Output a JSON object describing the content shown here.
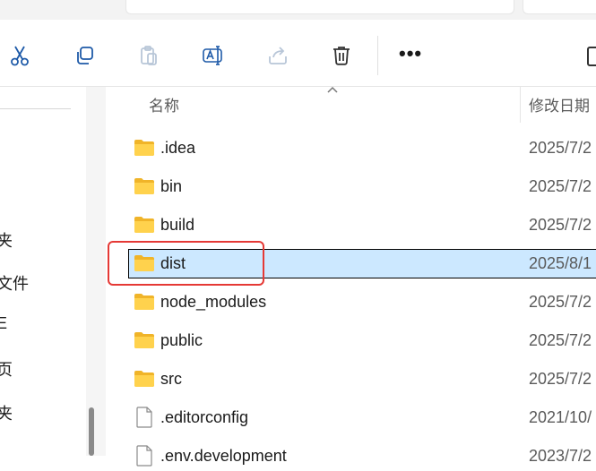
{
  "toolbar": {
    "buttons": [
      {
        "name": "cut-icon"
      },
      {
        "name": "copy-icon"
      },
      {
        "name": "paste-icon"
      },
      {
        "name": "rename-icon"
      },
      {
        "name": "share-icon"
      },
      {
        "name": "delete-icon"
      }
    ],
    "more_label": "•••"
  },
  "nav": {
    "items": [
      "夹",
      "文件",
      "E",
      "页",
      "夹"
    ]
  },
  "list": {
    "columns": {
      "name": "名称",
      "date": "修改日期"
    },
    "rows": [
      {
        "name": ".idea",
        "date": "2025/7/2",
        "type": "folder",
        "selected": false
      },
      {
        "name": "bin",
        "date": "2025/7/2",
        "type": "folder",
        "selected": false
      },
      {
        "name": "build",
        "date": "2025/7/2",
        "type": "folder",
        "selected": false
      },
      {
        "name": "dist",
        "date": "2025/8/1",
        "type": "folder",
        "selected": true
      },
      {
        "name": "node_modules",
        "date": "2025/7/2",
        "type": "folder",
        "selected": false
      },
      {
        "name": "public",
        "date": "2025/7/2",
        "type": "folder",
        "selected": false
      },
      {
        "name": "src",
        "date": "2025/7/2",
        "type": "folder",
        "selected": false
      },
      {
        "name": ".editorconfig",
        "date": "2021/10/",
        "type": "file",
        "selected": false
      },
      {
        "name": ".env.development",
        "date": "2023/7/2",
        "type": "file",
        "selected": false
      }
    ]
  },
  "colors": {
    "selection": "#cce8ff",
    "highlight_box": "#e53935",
    "folder": "#f8c93b"
  }
}
